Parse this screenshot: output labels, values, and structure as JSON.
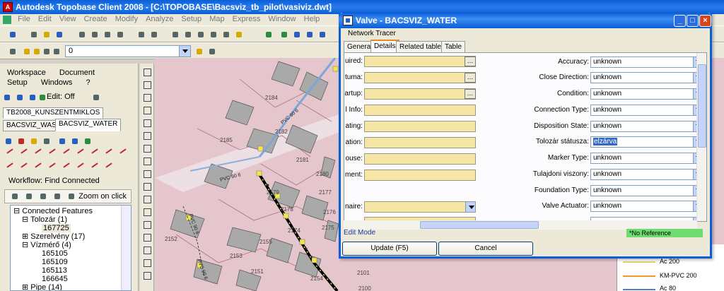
{
  "app": {
    "title": "Autodesk Topobase Client 2008 - [C:\\TOPOBASE\\Bacsviz_tb_pilot\\vasiviz.dwt]",
    "menu": [
      "File",
      "Edit",
      "View",
      "Create",
      "Modify",
      "Analyze",
      "Setup",
      "Map",
      "Express",
      "Window",
      "Help"
    ]
  },
  "layer": {
    "current": "0"
  },
  "left_panel": {
    "menu": [
      "Workspace",
      "Document",
      "Setup",
      "Windows",
      "?"
    ],
    "edit_state": "Edit: Off",
    "workspace_tab": "TB2008_KUNSZENTMIKLOS",
    "tabs": [
      "BACSVIZ_WASTE",
      "BACSVIZ_WATER"
    ],
    "workflow": "Workflow: Find Connected",
    "zoom_label": "Zoom on click",
    "tree": {
      "root": "Connected Features",
      "items": [
        {
          "label": "Tolozár (1)",
          "level": 1
        },
        {
          "label": "167725",
          "level": 2,
          "selected": true
        },
        {
          "label": "Szerelvény (17)",
          "level": 1
        },
        {
          "label": "Vízmérő (4)",
          "level": 1
        },
        {
          "label": "165105",
          "level": 2
        },
        {
          "label": "165109",
          "level": 2
        },
        {
          "label": "165113",
          "level": 2
        },
        {
          "label": "166645",
          "level": 2
        },
        {
          "label": "Pipe (14)",
          "level": 1
        }
      ]
    }
  },
  "map": {
    "parcels": [
      "2184",
      "2182",
      "2181",
      "2185",
      "2180",
      "2179",
      "2178",
      "2177",
      "2176",
      "2175",
      "2174",
      "2152",
      "2155",
      "2153",
      "2151",
      "2154",
      "2101",
      "2100"
    ],
    "pipe_labels": [
      "PVC 90 6",
      "PVC 90 6",
      "PVC 90 6",
      "PVC 90 6"
    ]
  },
  "legend": {
    "items": [
      {
        "label": "Ac 200",
        "color": "#e8d070"
      },
      {
        "label": "KM-PVC 200",
        "color": "#e8a020"
      },
      {
        "label": "Ac 80",
        "color": "#5080c0"
      }
    ]
  },
  "dialog": {
    "title": "Valve - BACSVIZ_WATER",
    "network_tracer": "Network Tracer",
    "tabs": [
      "General",
      "Details",
      "Related tables",
      "Table"
    ],
    "active_tab": "Details",
    "left_fields": [
      {
        "label": "uired:",
        "kind": "browse"
      },
      {
        "label": "tuma:",
        "kind": "browse"
      },
      {
        "label": "artup:",
        "kind": "browse"
      },
      {
        "label": "l Info:",
        "kind": "text"
      },
      {
        "label": "ating:",
        "kind": "text"
      },
      {
        "label": "ation:",
        "kind": "text"
      },
      {
        "label": "ouse:",
        "kind": "text"
      },
      {
        "label": "ment:",
        "kind": "text"
      },
      {
        "label": "naire:",
        "kind": "combo"
      },
      {
        "label": "",
        "kind": "combo"
      }
    ],
    "right_fields": [
      {
        "label": "Accuracy:",
        "value": "unknown"
      },
      {
        "label": "Close Direction:",
        "value": "unknown"
      },
      {
        "label": "Condition:",
        "value": "unknown"
      },
      {
        "label": "Connection Type:",
        "value": "unknown"
      },
      {
        "label": "Disposition State:",
        "value": "unknown"
      },
      {
        "label": "Tolozár státusza:",
        "value": "elzárva",
        "highlight": true
      },
      {
        "label": "Marker Type:",
        "value": "unknown"
      },
      {
        "label": "Tulajdoni viszony:",
        "value": "unknown"
      },
      {
        "label": "Foundation Type:",
        "value": "unknown"
      },
      {
        "label": "Valve Actuator:",
        "value": "unknown"
      }
    ],
    "status_mode": "Edit Mode",
    "status_reference": "*No Reference",
    "update_button": "Update (F5)",
    "cancel_button": "Cancel"
  }
}
